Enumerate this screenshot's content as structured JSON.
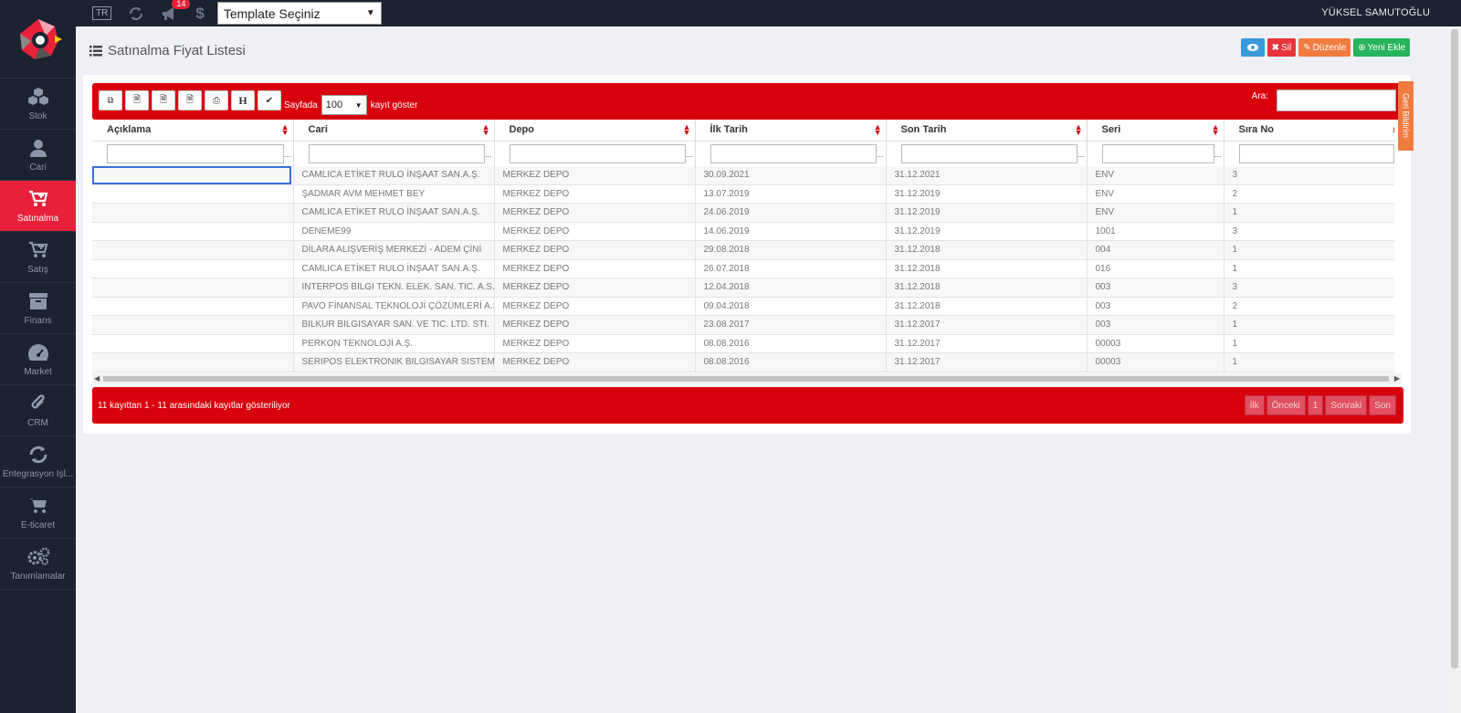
{
  "topbar": {
    "lang": "TR",
    "badge_count": "14",
    "template_select": "Template Seçiniz",
    "user": "YÜKSEL SAMUTOĞLU"
  },
  "sidebar": {
    "items": [
      {
        "label": "Stok",
        "icon": "cubes-icon"
      },
      {
        "label": "Cari",
        "icon": "user-icon"
      },
      {
        "label": "Satınalma",
        "icon": "cart-plus-icon",
        "active": true
      },
      {
        "label": "Satış",
        "icon": "cart-icon"
      },
      {
        "label": "Finans",
        "icon": "archive-icon"
      },
      {
        "label": "Market",
        "icon": "dashboard-icon"
      },
      {
        "label": "CRM",
        "icon": "paperclip-icon"
      },
      {
        "label": "Entegrasyon İşl...",
        "icon": "refresh-icon"
      },
      {
        "label": "E-ticaret",
        "icon": "shopping-cart-icon"
      },
      {
        "label": "Tanımlamalar",
        "icon": "gears-icon"
      }
    ]
  },
  "page": {
    "title": "Satınalma Fiyat Listesi",
    "actions": {
      "delete": "Sil",
      "edit": "Düzenle",
      "add": "Yeni Ekle"
    }
  },
  "toolbar": {
    "h_label": "H",
    "sayfada": "Sayfada",
    "page_size": "100",
    "kayit_goster": "kayıt göster",
    "search_label": "Ara:"
  },
  "table": {
    "columns": [
      "Açıklama",
      "Cari",
      "Depo",
      "İlk Tarih",
      "Son Tarih",
      "Seri",
      "Sıra No"
    ],
    "rows": [
      [
        "",
        "CAMLICA ETİKET RULO İNŞAAT SAN.A.Ş.",
        "MERKEZ DEPO",
        "30.09.2021",
        "31.12.2021",
        "ENV",
        "3"
      ],
      [
        "",
        "ŞADMAR AVM MEHMET BEY",
        "MERKEZ DEPO",
        "13.07.2019",
        "31.12.2019",
        "ENV",
        "2"
      ],
      [
        "",
        "CAMLICA ETİKET RULO İNŞAAT SAN.A.Ş.",
        "MERKEZ DEPO",
        "24.06.2019",
        "31.12.2019",
        "ENV",
        "1"
      ],
      [
        "",
        "DENEME99",
        "MERKEZ DEPO",
        "14.06.2019",
        "31.12.2019",
        "1001",
        "3"
      ],
      [
        "",
        "DİLARA ALIŞVERİŞ MERKEZİ - ADEM ÇİNİ",
        "MERKEZ DEPO",
        "29.08.2018",
        "31.12.2018",
        "004",
        "1"
      ],
      [
        "",
        "CAMLICA ETİKET RULO İNŞAAT SAN.A.Ş.",
        "MERKEZ DEPO",
        "26.07.2018",
        "31.12.2018",
        "016",
        "1"
      ],
      [
        "",
        "INTERPOS BILGI TEKN. ELEK. SAN. TIC. A.S.",
        "MERKEZ DEPO",
        "12.04.2018",
        "31.12.2018",
        "003",
        "3"
      ],
      [
        "",
        "PAVO FİNANSAL TEKNOLOJİ ÇÖZÜMLERİ A.Ş.",
        "MERKEZ DEPO",
        "09.04.2018",
        "31.12.2018",
        "003",
        "2"
      ],
      [
        "",
        "BILKUR BILGISAYAR SAN. VE TIC. LTD. STI.",
        "MERKEZ DEPO",
        "23.08.2017",
        "31.12.2017",
        "003",
        "1"
      ],
      [
        "",
        "PERKON TEKNOLOJİ A.Ş.",
        "MERKEZ DEPO",
        "08.08.2016",
        "31.12.2017",
        "00003",
        "1"
      ],
      [
        "",
        "SERIPOS ELEKTRONIK BILGISAYAR SISTEMLE...",
        "MERKEZ DEPO",
        "08.08.2016",
        "31.12.2017",
        "00003",
        "1"
      ]
    ]
  },
  "footer": {
    "info": "11 kayıttan 1 - 11 arasındaki kayıtlar gösteriliyor",
    "pager": [
      "İlk",
      "Önceki",
      "1",
      "Sonraki",
      "Son"
    ]
  },
  "feedback_tab": "Geri Bildirim"
}
